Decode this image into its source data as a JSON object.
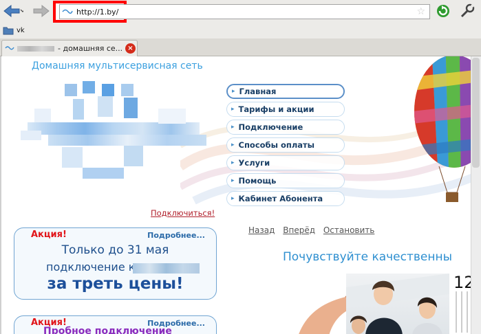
{
  "browser": {
    "url": "http://1.by/",
    "bookmark_label": "vk",
    "tab_title": "- домашняя се..."
  },
  "site": {
    "title": "Домашняя мультисервисная сеть",
    "subscribe_link": "Подключиться!"
  },
  "menu": [
    {
      "label": "Главная",
      "active": true
    },
    {
      "label": "Тарифы и акции",
      "active": false
    },
    {
      "label": "Подключение",
      "active": false
    },
    {
      "label": "Способы оплаты",
      "active": false
    },
    {
      "label": "Услуги",
      "active": false
    },
    {
      "label": "Помощь",
      "active": false
    },
    {
      "label": "Кабинет Абонента",
      "active": false
    }
  ],
  "promo1": {
    "badge": "Акция!",
    "more": "Подробнее...",
    "line1": "Только до 31 мая",
    "line2": "подключение к",
    "line3": "за треть цены!"
  },
  "promo2": {
    "badge": "Акция!",
    "more": "Подробнее...",
    "line1": "Пробное подключение"
  },
  "slider": {
    "back": "Назад",
    "forward": "Вперёд",
    "stop": "Остановить"
  },
  "tagline": "Почувствуйте качественны",
  "calendar_number": "12",
  "colors": {
    "accent": "#3ca0df",
    "menu_text": "#1a3f66",
    "promo_red": "#e1151a",
    "highlight_box": "#ff0000"
  }
}
